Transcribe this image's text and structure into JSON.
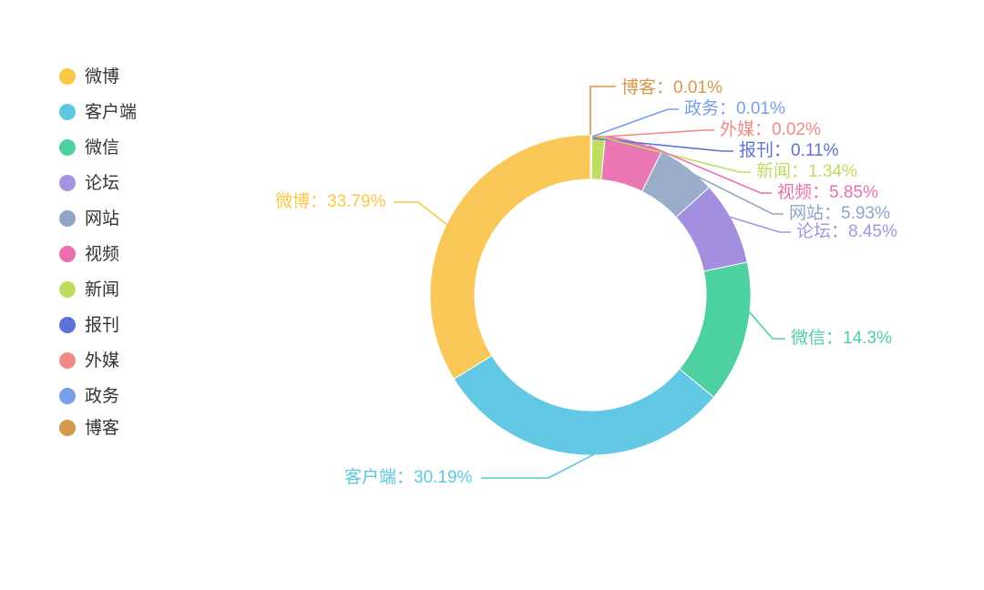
{
  "chart_data": {
    "type": "pie",
    "variant": "donut",
    "title": "",
    "xlabel": "",
    "ylabel": "",
    "unit": "%",
    "legend_position": "left",
    "grid": false,
    "categories": [
      "微博",
      "客户端",
      "微信",
      "论坛",
      "网站",
      "视频",
      "新闻",
      "报刊",
      "外媒",
      "政务",
      "博客"
    ],
    "values": [
      33.79,
      30.19,
      14.3,
      8.45,
      5.93,
      5.85,
      1.34,
      0.11,
      0.02,
      0.01,
      0.01
    ],
    "colors": [
      "#fac858",
      "#62c8e3",
      "#4ed1a0",
      "#a48ee0",
      "#9aaecb",
      "#ea76b4",
      "#bfdd62",
      "#5b73d8",
      "#ef8a87",
      "#789fe8",
      "#d19245"
    ],
    "labels": [
      "微博：33.79%",
      "客户端：30.19%",
      "微信：14.3%",
      "论坛：8.45%",
      "网站：5.93%",
      "视频：5.85%",
      "新闻：1.34%",
      "报刊：0.11%",
      "外媒：0.02%",
      "政务：0.01%",
      "博客：0.01%"
    ]
  },
  "legend": {
    "items": [
      {
        "label": "微博",
        "color": "#fbc846"
      },
      {
        "label": "客户端",
        "color": "#5cc8e0"
      },
      {
        "label": "微信",
        "color": "#4ed1a0"
      },
      {
        "label": "论坛",
        "color": "#a693e0"
      },
      {
        "label": "网站",
        "color": "#90a5c6"
      },
      {
        "label": "视频",
        "color": "#ea6fae"
      },
      {
        "label": "新闻",
        "color": "#bedd5e"
      },
      {
        "label": "报刊",
        "color": "#5b73d8"
      },
      {
        "label": "外媒",
        "color": "#ef8a87"
      },
      {
        "label": "政务",
        "color": "#789fe8"
      },
      {
        "label": "博客",
        "color": "#d4994b"
      }
    ]
  },
  "slice_labels": {
    "weibo": {
      "text": "微博：33.79%",
      "color": "#fbc846"
    },
    "client": {
      "text": "客户端：30.19%",
      "color": "#5cc8e0"
    },
    "wechat": {
      "text": "微信：14.3%",
      "color": "#4ed1a0"
    },
    "forum": {
      "text": "论坛：8.45%",
      "color": "#a693e0"
    },
    "website": {
      "text": "网站：5.93%",
      "color": "#90a5c6"
    },
    "video": {
      "text": "视频：5.85%",
      "color": "#ea6fae"
    },
    "news": {
      "text": "新闻：1.34%",
      "color": "#bedd5e"
    },
    "press": {
      "text": "报刊：0.11%",
      "color": "#5b73d8"
    },
    "foreign": {
      "text": "外媒：0.02%",
      "color": "#ef8a87"
    },
    "government": {
      "text": "政务：0.01%",
      "color": "#789fe8"
    },
    "blog": {
      "text": "博客：0.01%",
      "color": "#d4994b"
    }
  }
}
